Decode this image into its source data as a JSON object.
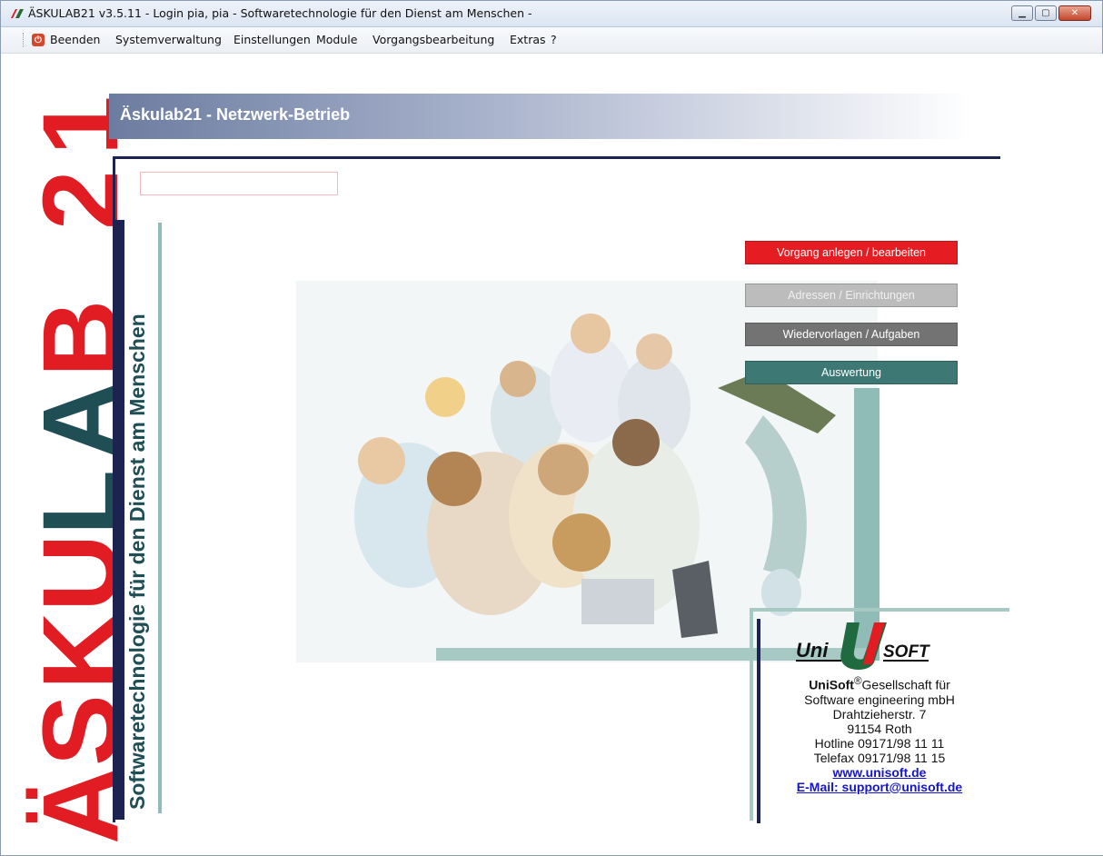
{
  "window": {
    "title": "ÄSKULAB21 v3.5.11 - Login pia, pia - Softwaretechnologie für den Dienst am Menschen -",
    "controls": [
      "minimize-icon",
      "maximize-icon",
      "close-icon"
    ]
  },
  "menu": {
    "items": [
      "Beenden",
      "Systemverwaltung",
      "Einstellungen",
      "Module",
      "Vorgangsbearbeitung",
      "Extras",
      "?"
    ]
  },
  "brand": {
    "vertical_logo_letters": [
      "Ä",
      "S",
      "K",
      "U",
      "L",
      "A",
      "B",
      "2",
      "1"
    ],
    "slogan": "Softwaretechnologie für den Dienst am Menschen",
    "banner_title": "Äskulab21 - Netzwerk-Betrieb",
    "colors": {
      "red": "#e11c22",
      "navy": "#1c2350",
      "teal": "#3e7874",
      "light_teal": "#a6c9c4"
    }
  },
  "search": {
    "value": ""
  },
  "actions": {
    "vorgang": "Vorgang anlegen / bearbeiten",
    "adressen": "Adressen / Einrichtungen",
    "wiedervorlagen": "Wiedervorlagen / Aufgaben",
    "auswertung": "Auswertung"
  },
  "company": {
    "logo_left": "Uni",
    "logo_right": "SOFT",
    "name": "UniSoft",
    "name_rest": "Gesellschaft für",
    "line2": "Software engineering mbH",
    "street": "Drahtzieherstr. 7",
    "city": "91154 Roth",
    "hotline": "Hotline 09171/98 11 11",
    "telefax": "Telefax 09171/98 11 15",
    "website": "www.unisoft.de",
    "email": "E-Mail: support@unisoft.de"
  }
}
